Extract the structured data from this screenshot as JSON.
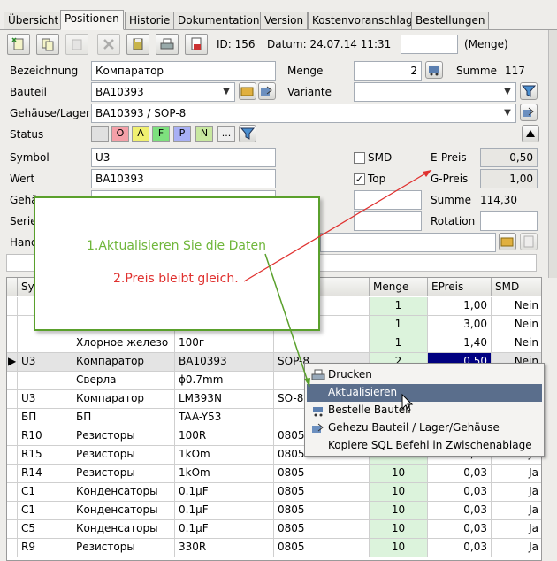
{
  "tabs": [
    "Übersicht",
    "Positionen",
    "Historie",
    "Dokumentation",
    "Version",
    "Kostenvoranschlag",
    "Bestellungen"
  ],
  "toolbar": {
    "id_label": "ID: 156",
    "date_label": "Datum: 24.07.14 11:31",
    "qty_placeholder": "",
    "qty_suffix": "(Menge)"
  },
  "form": {
    "bezeichnung_label": "Bezeichnung",
    "bezeichnung_value": "Компаратор",
    "menge_label": "Menge",
    "menge_value": "2",
    "summe_label": "Summe",
    "summe_value": "117",
    "bauteil_label": "Bauteil",
    "bauteil_value": "BA10393",
    "variante_label": "Variante",
    "variante_value": "",
    "gehaeuse_label": "Gehäuse/Lager",
    "gehaeuse_value": "BA10393 / SOP-8",
    "status_label": "Status",
    "status_chips": [
      "",
      "O",
      "A",
      "F",
      "P",
      "N",
      "..."
    ],
    "symbol_label": "Symbol",
    "symbol_value": "U3",
    "wert_label": "Wert",
    "wert_value": "BA10393",
    "smd_label": "SMD",
    "top_label": "Top",
    "epreis_label": "E-Preis",
    "epreis_value": "0,50",
    "gpreis_label": "G-Preis",
    "gpreis_value": "1,00",
    "summe2_label": "Summe",
    "summe2_value": "114,30",
    "rotation_label": "Rotation",
    "rotation_value": "",
    "gehae_partial": "Gehä",
    "serie_partial": "Serie",
    "hand_partial": "Hand"
  },
  "table": {
    "headers": [
      "Sy",
      "",
      "",
      "",
      "Menge",
      "EPreis",
      "SMD"
    ],
    "rows": [
      {
        "sym": "",
        "bez": "",
        "wert": "",
        "geh": "",
        "menge": "1",
        "epreis": "1,00",
        "smd": "Nein"
      },
      {
        "sym": "",
        "bez": "",
        "wert": "",
        "geh": "",
        "menge": "1",
        "epreis": "3,00",
        "smd": "Nein"
      },
      {
        "sym": "",
        "bez": "Хлорное железо",
        "wert": "100г",
        "geh": "",
        "menge": "1",
        "epreis": "1,40",
        "smd": "Nein"
      },
      {
        "sym": "U3",
        "bez": "Компаратор",
        "wert": "BA10393",
        "geh": "SOP-8",
        "menge": "2",
        "epreis": "0,50",
        "smd": "Nein"
      },
      {
        "sym": "",
        "bez": "Сверла",
        "wert": "ϕ0.7mm",
        "geh": "",
        "menge": "",
        "epreis": "",
        "smd": ""
      },
      {
        "sym": "U3",
        "bez": "Компаратор",
        "wert": "LM393N",
        "geh": "SO-8",
        "menge": "",
        "epreis": "",
        "smd": ""
      },
      {
        "sym": "БП",
        "bez": "БП",
        "wert": "TAA-Y53",
        "geh": "",
        "menge": "",
        "epreis": "",
        "smd": ""
      },
      {
        "sym": "R10",
        "bez": "Резисторы",
        "wert": "100R",
        "geh": "0805",
        "menge": "",
        "epreis": "",
        "smd": ""
      },
      {
        "sym": "R15",
        "bez": "Резисторы",
        "wert": "1kOm",
        "geh": "0805",
        "menge": "10",
        "epreis": "0,03",
        "smd": "Ja"
      },
      {
        "sym": "R14",
        "bez": "Резисторы",
        "wert": "1kOm",
        "geh": "0805",
        "menge": "10",
        "epreis": "0,03",
        "smd": "Ja"
      },
      {
        "sym": "C1",
        "bez": "Конденсаторы",
        "wert": "0.1μF",
        "geh": "0805",
        "menge": "10",
        "epreis": "0,03",
        "smd": "Ja"
      },
      {
        "sym": "C1",
        "bez": "Конденсаторы",
        "wert": "0.1μF",
        "geh": "0805",
        "menge": "10",
        "epreis": "0,03",
        "smd": "Ja"
      },
      {
        "sym": "C5",
        "bez": "Конденсаторы",
        "wert": "0.1μF",
        "geh": "0805",
        "menge": "10",
        "epreis": "0,03",
        "smd": "Ja"
      },
      {
        "sym": "R9",
        "bez": "Резисторы",
        "wert": "330R",
        "geh": "0805",
        "menge": "10",
        "epreis": "0,03",
        "smd": "Ja"
      }
    ]
  },
  "context_menu": {
    "items": [
      "Drucken",
      "Aktualisieren",
      "Bestelle Bauteil",
      "Gehezu Bauteil / Lager/Gehäuse",
      "Kopiere SQL Befehl in Zwischenablage"
    ]
  },
  "callout": {
    "line1": "1.Aktualisieren Sie die Daten",
    "line2": "2.Preis bleibt gleich."
  },
  "colors": {
    "accent_green": "#5aa02c",
    "annotation_red": "#e0312f",
    "menu_highlight": "#5a6e8c",
    "selection": "#000080"
  }
}
